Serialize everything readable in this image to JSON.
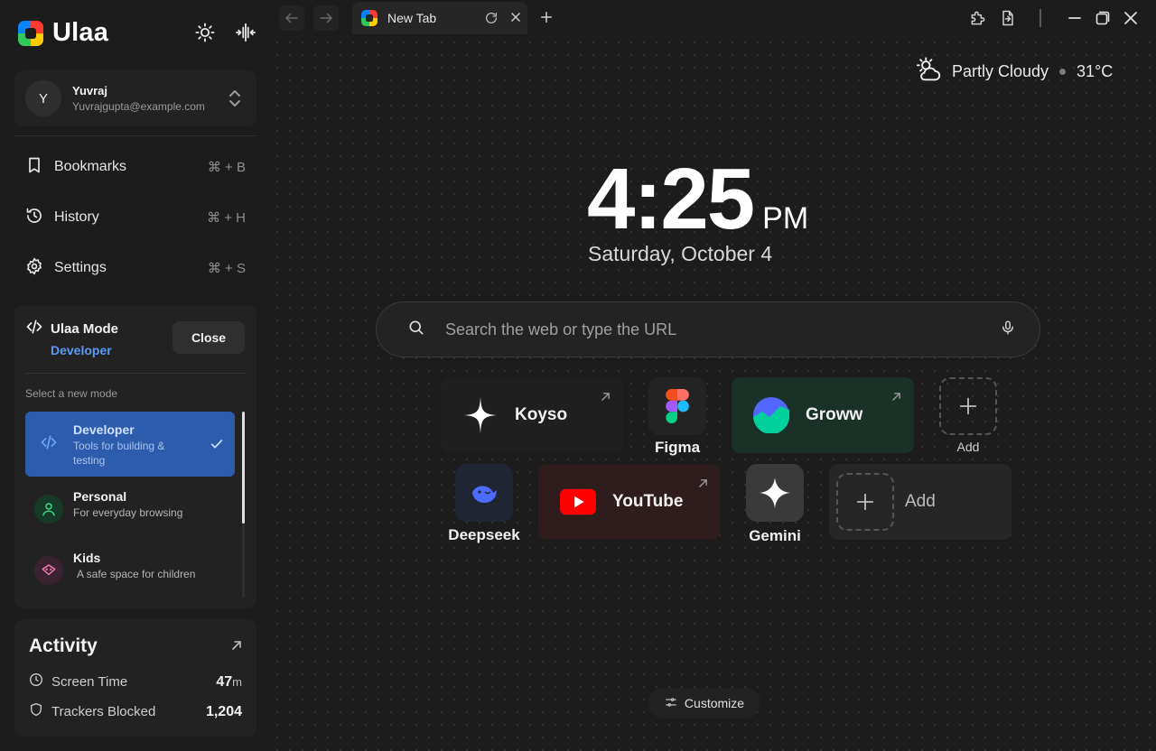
{
  "app": {
    "name": "Ulaa"
  },
  "profile": {
    "initial": "Y",
    "name": "Yuvraj",
    "email": "Yuvrajgupta@example.com"
  },
  "nav": [
    {
      "label": "Bookmarks",
      "shortcut": "⌘ + B",
      "icon": "bookmark-icon"
    },
    {
      "label": "History",
      "shortcut": "⌘ + H",
      "icon": "history-icon"
    },
    {
      "label": "Settings",
      "shortcut": "⌘ + S",
      "icon": "gear-icon"
    }
  ],
  "mode": {
    "title": "Ulaa Mode",
    "current": "Developer",
    "close_label": "Close",
    "select_prompt": "Select a new mode",
    "options": [
      {
        "name": "Developer",
        "desc": "Tools for building & testing",
        "selected": true
      },
      {
        "name": "Personal",
        "desc": "For everyday browsing",
        "selected": false
      },
      {
        "name": "Kids",
        "desc": "A safe space for children",
        "selected": false
      }
    ]
  },
  "activity": {
    "title": "Activity",
    "screen_time_label": "Screen Time",
    "screen_time_value": "47",
    "screen_time_unit": "m",
    "trackers_label": "Trackers Blocked",
    "trackers_value": "1,204"
  },
  "tab": {
    "title": "New Tab"
  },
  "weather": {
    "condition": "Partly Cloudy",
    "temp": "31°C"
  },
  "clock": {
    "time": "4:25",
    "ampm": "PM",
    "date": "Saturday, October 4"
  },
  "search": {
    "placeholder": "Search the web or type the URL"
  },
  "shortcuts": {
    "koyso": "Koyso",
    "figma": "Figma",
    "groww": "Groww",
    "add": "Add",
    "deepseek": "Deepseek",
    "youtube": "YouTube",
    "gemini": "Gemini",
    "add2": "Add"
  },
  "customize_label": "Customize",
  "colors": {
    "accent": "#2e5cad",
    "accent_text": "#5b9bf5",
    "groww": "#00d09c",
    "youtube": "#ff0000"
  }
}
